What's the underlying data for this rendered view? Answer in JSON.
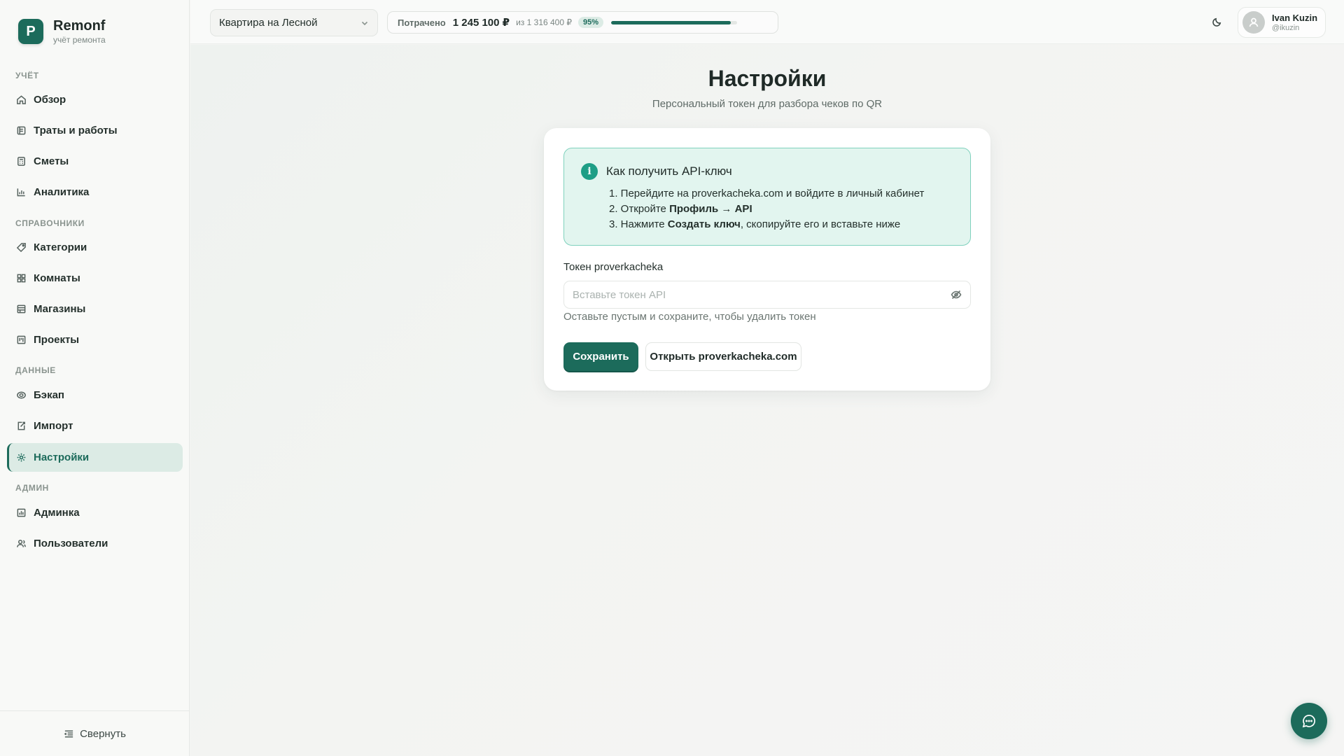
{
  "brand": {
    "logo_letter": "P",
    "name": "Remonf",
    "subtitle": "учёт ремонта"
  },
  "sidebar": {
    "sections": [
      {
        "label": "Учёт",
        "items": [
          {
            "label": "Обзор",
            "icon": "home-icon"
          },
          {
            "label": "Траты и работы",
            "icon": "receipt-icon"
          },
          {
            "label": "Сметы",
            "icon": "calculator-icon"
          },
          {
            "label": "Аналитика",
            "icon": "bar-chart-icon"
          }
        ]
      },
      {
        "label": "Справочники",
        "items": [
          {
            "label": "Категории",
            "icon": "tag-icon"
          },
          {
            "label": "Комнаты",
            "icon": "grid-icon"
          },
          {
            "label": "Магазины",
            "icon": "store-icon"
          },
          {
            "label": "Проекты",
            "icon": "kanban-icon"
          }
        ]
      },
      {
        "label": "Данные",
        "items": [
          {
            "label": "Бэкап",
            "icon": "database-icon"
          },
          {
            "label": "Импорт",
            "icon": "import-icon"
          },
          {
            "label": "Настройки",
            "icon": "gear-icon",
            "active": true
          }
        ]
      },
      {
        "label": "Админ",
        "items": [
          {
            "label": "Админка",
            "icon": "admin-chart-icon"
          },
          {
            "label": "Пользователи",
            "icon": "users-icon"
          }
        ]
      }
    ],
    "collapse_label": "Свернуть"
  },
  "header": {
    "project_select": {
      "value": "Квартира на Лесной"
    },
    "budget": {
      "label": "Потрачено",
      "spent": "1 245 100 ₽",
      "of": "из 1 316 400 ₽",
      "percent_label": "95%",
      "progress_fraction": 0.95
    },
    "user": {
      "name": "Ivan Kuzin",
      "handle": "@ikuzin"
    }
  },
  "main": {
    "title": "Настройки",
    "subtitle": "Персональный токен для разбора чеков по QR",
    "info": {
      "title": "Как получить API-ключ",
      "step1": "1. Перейдите на proverkacheka.com и войдите в личный кабинет",
      "step2_prefix": "2. Откройте ",
      "step2_bold": "Профиль → API",
      "step3_prefix": "3. Нажмите ",
      "step3_bold": "Создать ключ",
      "step3_suffix": ", скопируйте его и вставьте ниже"
    },
    "token_field": {
      "label": "Токен proverkacheka",
      "value": "",
      "placeholder": "Вставьте токен API",
      "hint": "Оставьте пустым и сохраните, чтобы удалить токен"
    },
    "save_label": "Сохранить",
    "open_label": "Открыть proverkacheka.com"
  },
  "colors": {
    "accent": "#1c6b5b",
    "info_bg": "#e2f5ef",
    "info_border": "#7fd1bd"
  }
}
